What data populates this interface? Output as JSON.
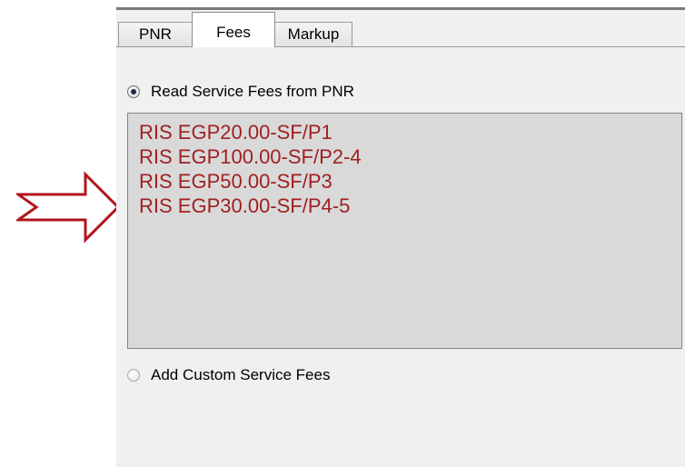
{
  "tabs": [
    {
      "label": "PNR",
      "selected": false
    },
    {
      "label": "Fees",
      "selected": true
    },
    {
      "label": "Markup",
      "selected": false
    }
  ],
  "fees_panel": {
    "read_option": {
      "label": "Read Service Fees from PNR",
      "checked": true
    },
    "fee_lines": [
      "RIS EGP20.00-SF/P1",
      "RIS EGP100.00-SF/P2-4",
      "RIS EGP50.00-SF/P3",
      "RIS EGP30.00-SF/P4-5"
    ],
    "custom_option": {
      "label": "Add Custom Service Fees",
      "checked": false
    }
  },
  "annotation": {
    "arrow_icon": "right-arrow-outline-icon",
    "color": "#b0161c"
  },
  "colors": {
    "fee_text": "#a02020",
    "fees_box_bg": "#d9d9d9",
    "panel_bg": "#f0f0f0"
  }
}
